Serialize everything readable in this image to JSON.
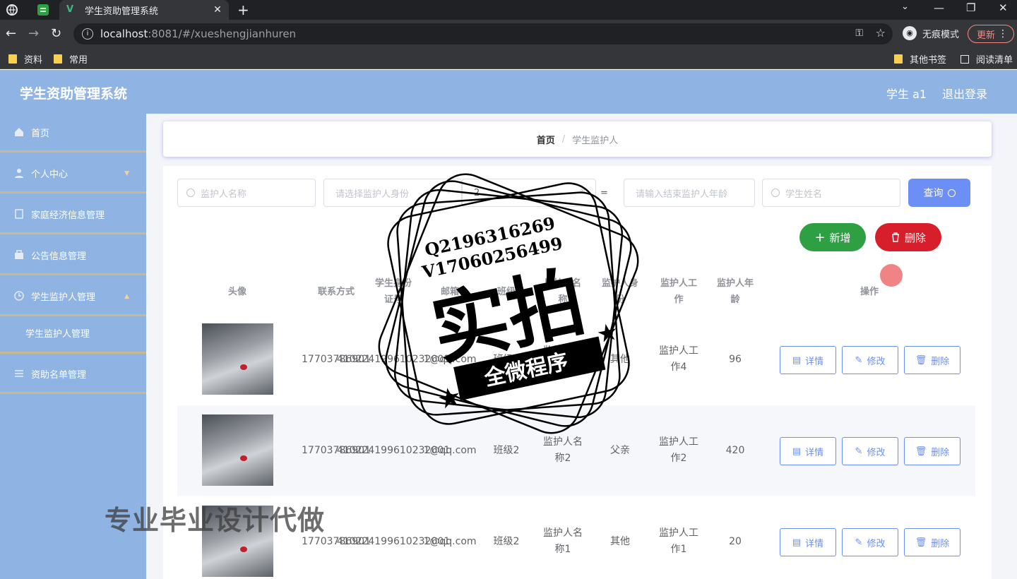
{
  "browser": {
    "tab_title": "学生资助管理系统",
    "tab_close": "✕",
    "new_tab": "+",
    "url_host": "localhost",
    "url_path": ":8081/#/xueshengjianhuren",
    "incognito_label": "无痕模式",
    "update_label": "更新",
    "bookmarks": [
      "资料",
      "常用"
    ],
    "other_bookmarks": "其他书签",
    "reading_list": "阅读清单"
  },
  "app": {
    "brand": "学生资助管理系统",
    "user": "学生 a1",
    "logout": "退出登录"
  },
  "sidebar": {
    "items": [
      {
        "label": "首页",
        "icon": "home-icon"
      },
      {
        "label": "个人中心",
        "icon": "user-icon"
      },
      {
        "label": "家庭经济信息管理",
        "icon": "doc-icon"
      },
      {
        "label": "公告信息管理",
        "icon": "bag-icon"
      },
      {
        "label": "学生监护人管理",
        "icon": "clock-icon"
      },
      {
        "label": "资助名单管理",
        "icon": "list-icon"
      }
    ],
    "sub_item": "学生监护人管理"
  },
  "breadcrumb": {
    "home": "首页",
    "separator": "/",
    "current": "学生监护人"
  },
  "search": {
    "name_placeholder": "监护人名称",
    "identity_placeholder": "请选择监护人身份",
    "field3_value": "2",
    "field4_value": "=",
    "age_placeholder": "请输入结束监护人年龄",
    "student_placeholder": "学生姓名",
    "query_label": "查询"
  },
  "actions": {
    "add_label": "新增",
    "delete_label": "删除"
  },
  "table": {
    "headers": {
      "avatar": "头像",
      "phone": "联系方式",
      "idcard": "学生身份证号",
      "email": "邮箱",
      "class": "班级",
      "name": "监护人名称",
      "identity": "监护人身份",
      "job": "监护人工作",
      "age": "监护人年龄",
      "ops": "操作"
    },
    "rows": [
      {
        "phone": "17703786901",
        "idcard": "410224199610232001",
        "email": "1@qq.com",
        "class": "班级2",
        "name": "监护人名称4",
        "identity": "其他",
        "job": "监护人工作4",
        "age": "96"
      },
      {
        "phone": "17703786901",
        "idcard": "410224199610232001",
        "email": "1@qq.com",
        "class": "班级2",
        "name": "监护人名称2",
        "identity": "父亲",
        "job": "监护人工作2",
        "age": "420"
      },
      {
        "phone": "17703786901",
        "idcard": "410224199610232001",
        "email": "1@qq.com",
        "class": "班级2",
        "name": "监护人名称1",
        "identity": "其他",
        "job": "监护人工作1",
        "age": "20"
      }
    ],
    "op_detail": "详情",
    "op_edit": "修改",
    "op_delete": "删除"
  },
  "watermark": {
    "qq": "Q2196316269",
    "wx": "V17060256499",
    "big": "实拍",
    "banner": "全微程序",
    "bottom": "专业毕业设计代做"
  }
}
